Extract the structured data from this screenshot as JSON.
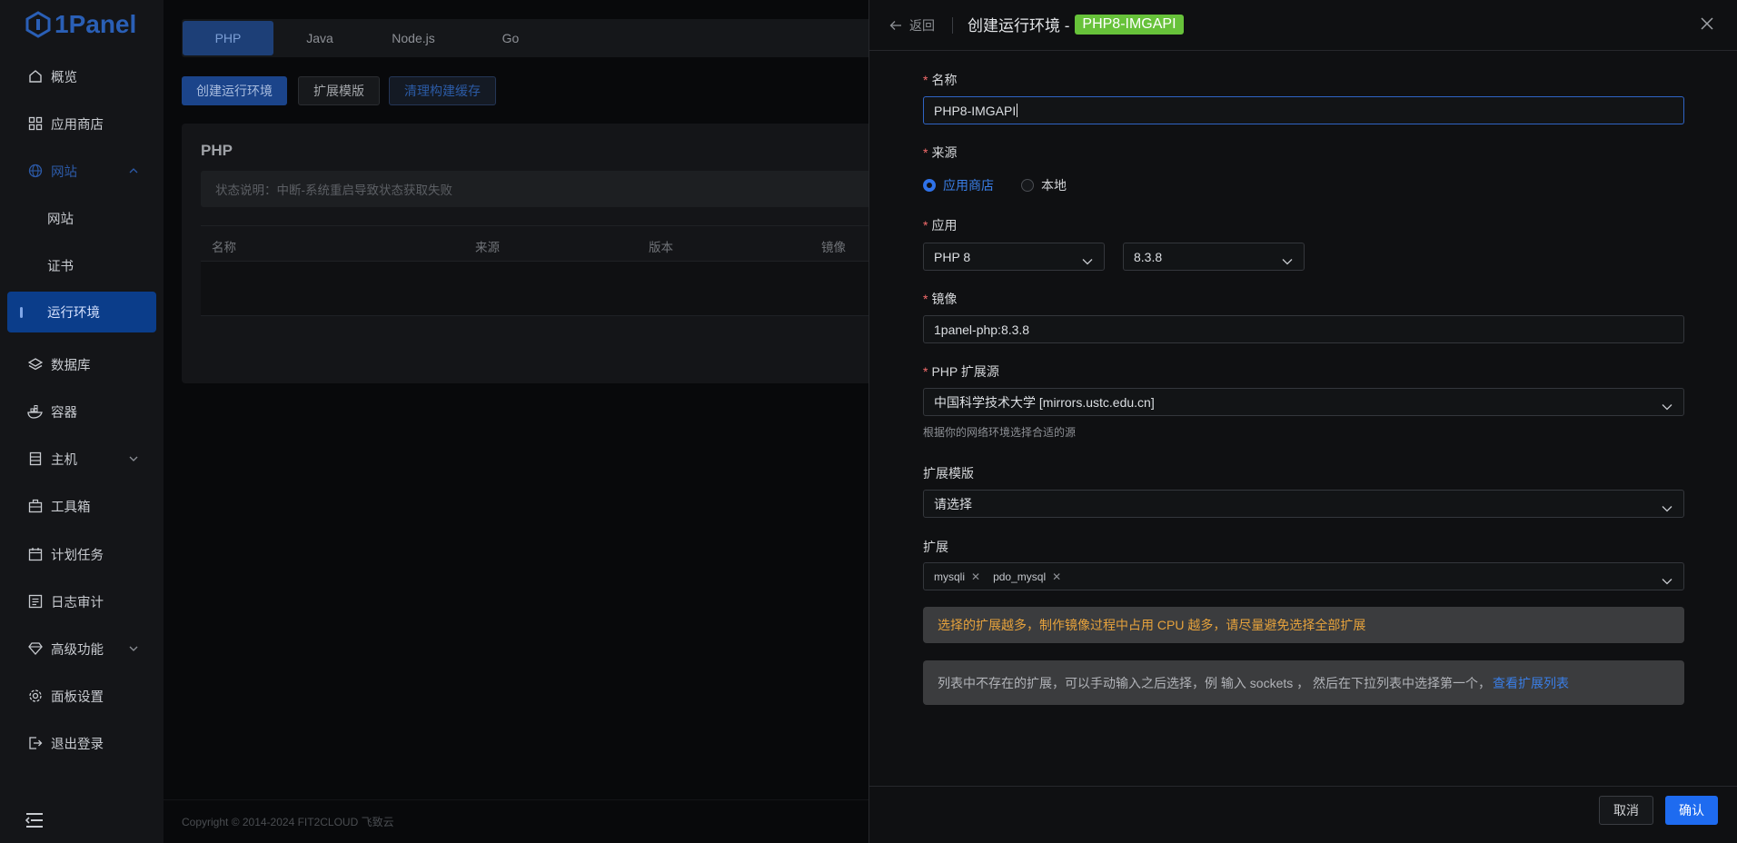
{
  "logo": {
    "text": "1Panel"
  },
  "sidebar": {
    "items": [
      {
        "label": "概览"
      },
      {
        "label": "应用商店"
      },
      {
        "label": "网站"
      },
      {
        "label": "网站"
      },
      {
        "label": "证书"
      },
      {
        "label": "运行环境"
      },
      {
        "label": "数据库"
      },
      {
        "label": "容器"
      },
      {
        "label": "主机"
      },
      {
        "label": "工具箱"
      },
      {
        "label": "计划任务"
      },
      {
        "label": "日志审计"
      },
      {
        "label": "高级功能"
      },
      {
        "label": "面板设置"
      },
      {
        "label": "退出登录"
      }
    ]
  },
  "main": {
    "tabs": [
      {
        "label": "PHP"
      },
      {
        "label": "Java"
      },
      {
        "label": "Node.js"
      },
      {
        "label": "Go"
      }
    ],
    "buttons": {
      "create": "创建运行环境",
      "extensions": "扩展模版",
      "clear_cache": "清理构建缓存"
    },
    "card_title": "PHP",
    "alert": "状态说明：中断-系统重启导致状态获取失败",
    "columns": [
      "名称",
      "来源",
      "版本",
      "镜像"
    ],
    "footer": "Copyright © 2014-2024 FIT2CLOUD 飞致云"
  },
  "drawer": {
    "back": "返回",
    "title": "创建运行环境 -",
    "tag": "PHP8-IMGAPI",
    "fields": {
      "name_label": "名称",
      "name_value": "PHP8-IMGAPI",
      "source_label": "来源",
      "source_options": [
        "应用商店",
        "本地"
      ],
      "app_label": "应用",
      "app_value": "PHP 8",
      "version_value": "8.3.8",
      "image_label": "镜像",
      "image_value": "1panel-php:8.3.8",
      "ext_source_label": "PHP 扩展源",
      "ext_source_value": "中国科学技术大学 [mirrors.ustc.edu.cn]",
      "ext_source_hint": "根据你的网络环境选择合适的源",
      "template_label": "扩展模版",
      "template_placeholder": "请选择",
      "extensions_label": "扩展",
      "extensions": [
        "mysqli",
        "pdo_mysql"
      ]
    },
    "warning": "选择的扩展越多，制作镜像过程中占用 CPU 越多，请尽量避免选择全部扩展",
    "info": "列表中不存在的扩展，可以手动输入之后选择，例 输入 sockets ， 然后在下拉列表中选择第一个，",
    "info_link": "查看扩展列表",
    "cancel": "取消",
    "confirm": "确认"
  }
}
